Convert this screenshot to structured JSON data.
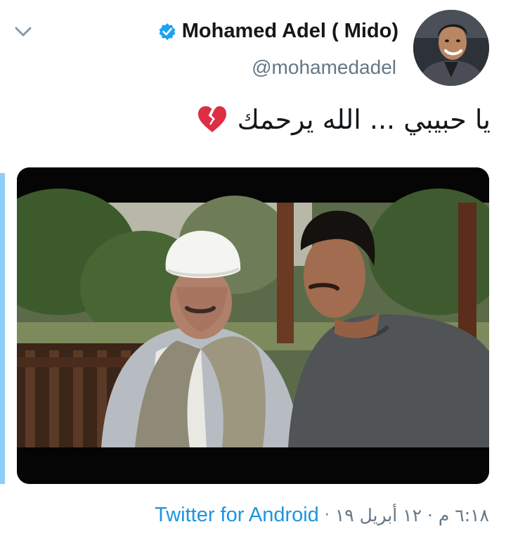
{
  "author": {
    "display_name": "Mohamed Adel ( Mido)",
    "handle": "@mohamedadel",
    "verified": true
  },
  "tweet": {
    "text": "يا حبيبي ... الله يرحمك",
    "emoji": "broken-heart"
  },
  "footer": {
    "timestamp": "٦:١٨ م · ١٢ أبريل ١٩",
    "separator": "·",
    "source": "Twitter for Android"
  },
  "icons": {
    "caret": "chevron-down-icon",
    "verified": "verified-badge-icon",
    "emoji": "broken-heart-icon"
  },
  "colors": {
    "link": "#1b95e0",
    "secondary_text": "#657786",
    "primary_text": "#14171a",
    "verified": "#1da1f2",
    "thread_line": "#8ecdf7",
    "broken_heart": "#dd2e44"
  }
}
